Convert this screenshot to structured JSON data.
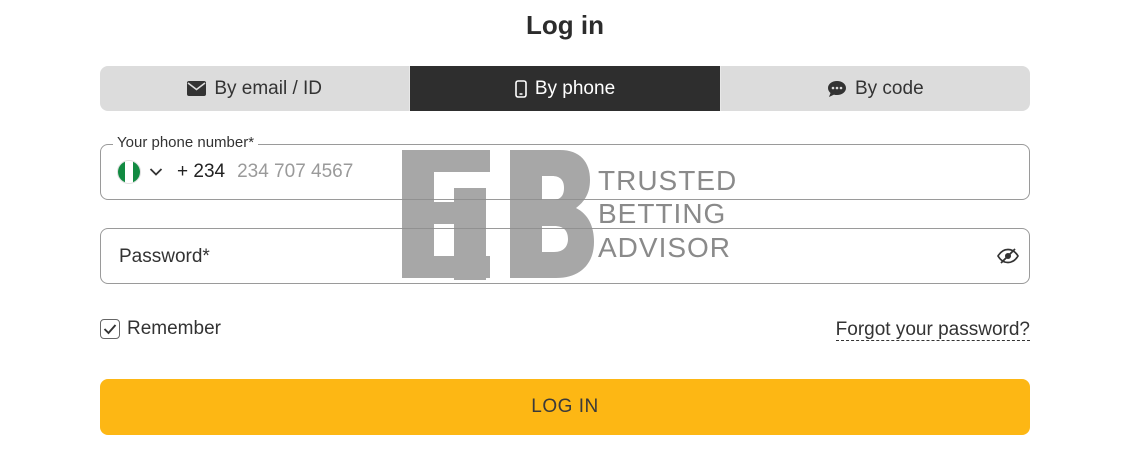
{
  "title": "Log in",
  "tabs": [
    {
      "label": "By email / ID",
      "icon": "envelope-icon",
      "active": false
    },
    {
      "label": "By phone",
      "icon": "mobile-phone-icon",
      "active": true
    },
    {
      "label": "By code",
      "icon": "chat-bubble-icon",
      "active": false
    }
  ],
  "phone": {
    "label": "Your phone number*",
    "country": "Nigeria",
    "country_code": "+ 234",
    "placeholder": "234 707 4567",
    "value": ""
  },
  "password": {
    "placeholder": "Password*",
    "value": "",
    "toggle_icon": "eye-hidden-icon"
  },
  "remember": {
    "label": "Remember",
    "checked": true
  },
  "forgot": {
    "label": "Forgot your password?"
  },
  "login_button": {
    "label": "LOG IN"
  },
  "watermark": {
    "lines": [
      "TRUSTED",
      "BETTING",
      "ADVISOR"
    ]
  },
  "colors": {
    "accent": "#fdb714",
    "tab_active_bg": "#2e2e2e",
    "tab_bg": "#dcdcdc",
    "flag_green": "#118a41"
  }
}
